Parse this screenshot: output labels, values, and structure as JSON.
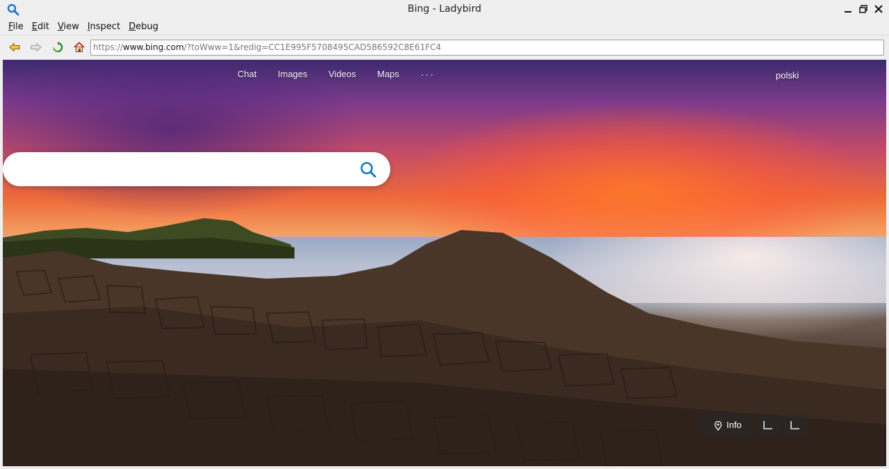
{
  "window": {
    "title": "Bing - Ladybird"
  },
  "menu": [
    {
      "label": "File",
      "mnemonic": "F",
      "rest": "ile"
    },
    {
      "label": "Edit",
      "mnemonic": "E",
      "rest": "dit"
    },
    {
      "label": "View",
      "mnemonic": "V",
      "rest": "iew"
    },
    {
      "label": "Inspect",
      "mnemonic": "I",
      "rest": "nspect"
    },
    {
      "label": "Debug",
      "mnemonic": "D",
      "rest": "ebug"
    }
  ],
  "toolbar": {
    "url_scheme": "https://",
    "url_host": "www.bing.com",
    "url_rest": "/?toWww=1&redig=CC1E995F5708495CAD586592C8E61FC4"
  },
  "page": {
    "nav": [
      "Chat",
      "Images",
      "Videos",
      "Maps"
    ],
    "more": "...",
    "language": "polski",
    "search_value": "",
    "info_label": "Info"
  },
  "colors": {
    "accent_search": "#0e7bb8",
    "back_arrow": "#b87400",
    "reload": "#2a8a2a",
    "home": "#c0392b"
  }
}
